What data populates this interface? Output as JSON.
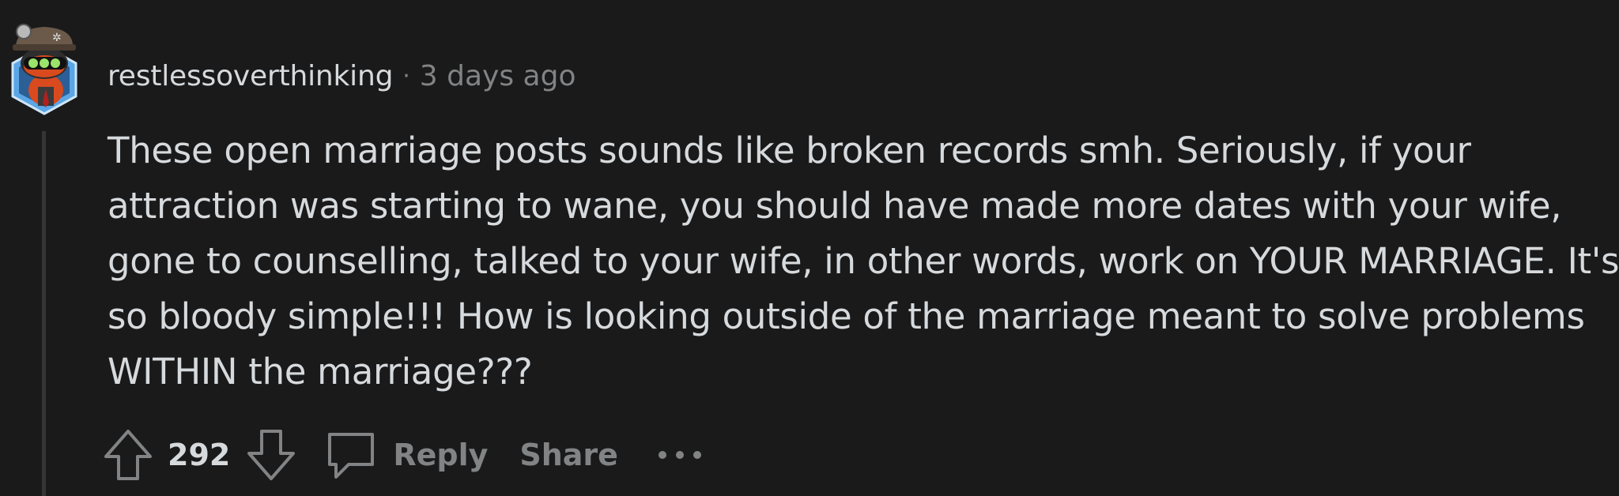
{
  "comment": {
    "author": "restlessoverthinking",
    "separator": "·",
    "timestamp": "3 days ago",
    "body_lines": [
      "These open marriage posts sounds like broken records smh. Seriously, if your",
      "attraction was starting to wane, you should have made more dates with your wife,",
      "gone to counselling, talked to your wife, in other words, work on YOUR MARRIAGE. It's",
      "so bloody simple!!! How is looking outside of the marriage meant to solve problems",
      "WITHIN the marriage???"
    ],
    "score": "292",
    "reply_label": "Reply",
    "share_label": "Share"
  },
  "icons": {
    "avatar": "snoo-avatar",
    "upvote": "arrow-up-icon",
    "downvote": "arrow-down-icon",
    "reply": "speech-bubble-icon",
    "more": "ellipsis-icon"
  },
  "colors": {
    "background": "#1a1a1b",
    "text": "#d7dadc",
    "muted": "#818384",
    "thread_line": "#343536"
  }
}
